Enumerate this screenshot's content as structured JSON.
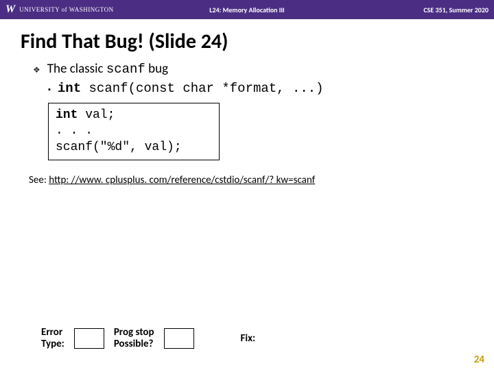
{
  "header": {
    "logo_letter": "W",
    "university": "UNIVERSITY of WASHINGTON",
    "lecture": "L24: Memory Allocation III",
    "course": "CSE 351, Summer 2020"
  },
  "title": "Find That Bug!  (Slide 24)",
  "bullet1_pre": "The classic ",
  "bullet1_code": "scanf",
  "bullet1_post": " bug",
  "bullet2_kw": "int",
  "bullet2_rest": " scanf(const char *format, ...)",
  "code_line1_kw": "int",
  "code_line1_rest": " val;",
  "code_line2": ". . .",
  "code_line3": "scanf(\"%d\", val);",
  "see_label": "See: ",
  "see_url_text": "http: //www. cplusplus. com/reference/cstdio/scanf/? kw=scanf",
  "see_url_href": "http://www.cplusplus.com/reference/cstdio/scanf/?kw=scanf",
  "bottom": {
    "error_type_l1": "Error",
    "error_type_l2": "Type:",
    "prog_stop_l1": "Prog stop",
    "prog_stop_l2": "Possible?",
    "fix": "Fix:"
  },
  "page_number": "24"
}
